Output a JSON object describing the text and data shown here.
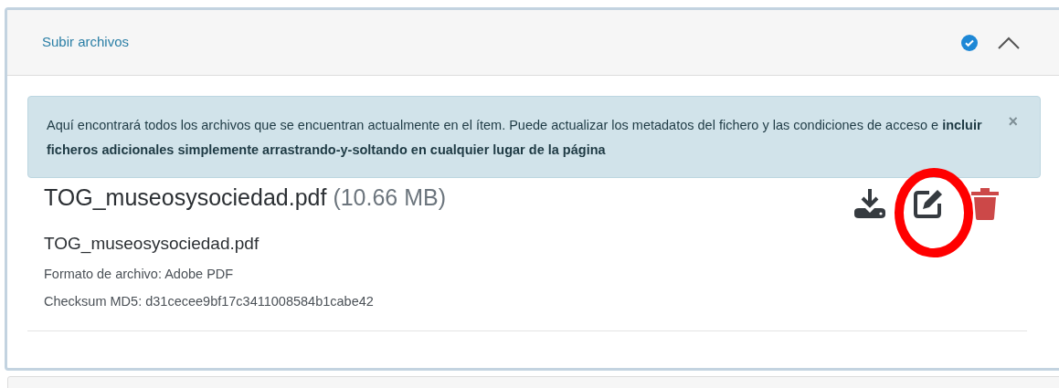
{
  "panel": {
    "title": "Subir archivos",
    "complete": true,
    "expanded": true
  },
  "alert": {
    "text": "Aquí encontrará todos los archivos que se encuentran actualmente en el ítem. Puede actualizar los metadatos del fichero y las condiciones de acceso e **incluir ficheros adicionales simplemente arrastrando-y-soltando en cualquier lugar de la página**",
    "close": "×"
  },
  "files": [
    {
      "name": "TOG_museosysociedad.pdf",
      "size": "(10.66 MB)",
      "filename": "TOG_museosysociedad.pdf",
      "format": "Formato de archivo: Adobe PDF",
      "checksum": "Checksum MD5: d31cecee9bf17c3411008584b1cabe42",
      "edit_highlighted": true
    }
  ]
}
